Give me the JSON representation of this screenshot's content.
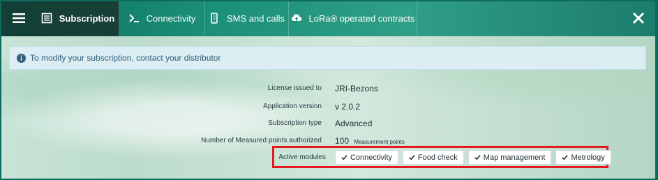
{
  "navigation": {
    "menu_icon": "menu-icon",
    "tabs": [
      {
        "id": "subscription",
        "label": "Subscription",
        "icon": "list-icon",
        "active": true
      },
      {
        "id": "connectivity",
        "label": "Connectivity",
        "icon": "terminal-icon",
        "active": false
      },
      {
        "id": "sms-calls",
        "label": "SMS and calls",
        "icon": "mobile-phone-icon",
        "active": false
      },
      {
        "id": "lora",
        "label": "LoRa® operated contracts",
        "icon": "cloud-upload-icon",
        "active": false
      }
    ],
    "close_icon": "close-icon"
  },
  "info_banner": {
    "icon": "info-icon",
    "text": "To modify your subscription, contact your distributor"
  },
  "details": [
    {
      "label": "License issued to",
      "value": "JRI-Bezons"
    },
    {
      "label": "Application version",
      "value": "v 2.0.2"
    },
    {
      "label": "Subscription type",
      "value": "Advanced"
    },
    {
      "label": "Number of Measured points authorized",
      "value": "100",
      "value_unit": "Measurement points"
    }
  ],
  "active_modules": {
    "label": "Active modules",
    "items": [
      {
        "label": "Connectivity",
        "icon": "check-icon"
      },
      {
        "label": "Food check",
        "icon": "check-icon"
      },
      {
        "label": "Map management",
        "icon": "check-icon"
      },
      {
        "label": "Metrology",
        "icon": "check-icon"
      }
    ]
  },
  "colors": {
    "header_teal": "#1b8f78",
    "active_tab": "#163f36",
    "info_background": "#dcedf4",
    "highlight_red": "#e31a22"
  }
}
